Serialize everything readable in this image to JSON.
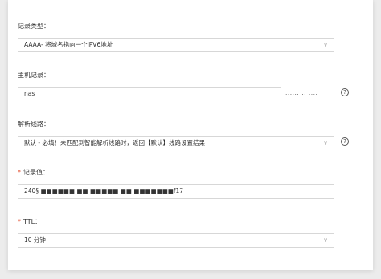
{
  "record_type": {
    "label": "记录类型：",
    "value": "AAAA- 将域名指向一个IPV6地址"
  },
  "host_record": {
    "label": "主机记录：",
    "value": "nas",
    "suffix": "...... .. ...."
  },
  "resolve_line": {
    "label": "解析线路：",
    "value": "默认 - 必填！未匹配到智能解析线路时，返回【默认】线路设置结果"
  },
  "record_value": {
    "required": "*",
    "label": "记录值：",
    "value": "240§ ■■■■■■ ■■ ■■■■■ ■■ ■■■■■■■f17"
  },
  "ttl": {
    "required": "*",
    "label": "TTL：",
    "value": "10 分钟"
  },
  "icons": {
    "help": "?",
    "chevron": "∨"
  }
}
